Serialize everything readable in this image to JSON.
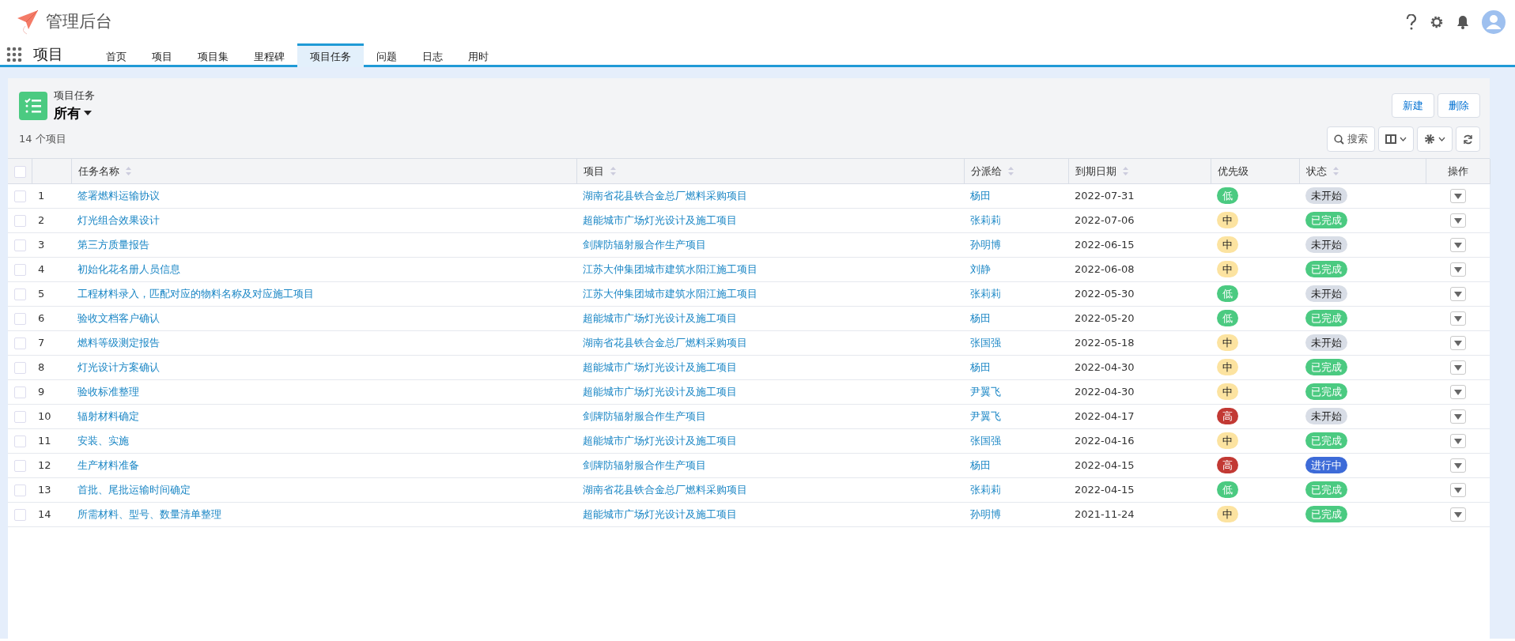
{
  "app": {
    "title": "管理后台"
  },
  "nav": {
    "section": "项目",
    "tabs": [
      {
        "label": "首页",
        "selected": false
      },
      {
        "label": "项目",
        "selected": false
      },
      {
        "label": "项目集",
        "selected": false
      },
      {
        "label": "里程碑",
        "selected": false
      },
      {
        "label": "项目任务",
        "selected": true
      },
      {
        "label": "问题",
        "selected": false
      },
      {
        "label": "日志",
        "selected": false
      },
      {
        "label": "用时",
        "selected": false
      }
    ]
  },
  "list_header": {
    "object": "项目任务",
    "view": "所有",
    "count": "14 个项目",
    "buttons": [
      "新建",
      "删除"
    ],
    "search_label": "搜索"
  },
  "table": {
    "all_checked": false,
    "columns": [
      {
        "label": "任务名称",
        "sortable": true
      },
      {
        "label": "项目",
        "sortable": true
      },
      {
        "label": "分派给",
        "sortable": true
      },
      {
        "label": "到期日期",
        "sortable": true
      },
      {
        "label": "优先级",
        "sortable": false
      },
      {
        "label": "状态",
        "sortable": true
      },
      {
        "label": "操作",
        "sortable": false
      }
    ],
    "rows": [
      {
        "num": "1",
        "name": "签署燃料运输协议",
        "project": "湖南省花县铁合金总厂燃料采购项目",
        "assignee": "杨田",
        "due": "2022-07-31",
        "priority": {
          "label": "低",
          "color": "#4bca81"
        },
        "status": {
          "label": "未开始",
          "color": "#d8dde6"
        },
        "checked": false
      },
      {
        "num": "2",
        "name": "灯光组合效果设计",
        "project": "超能城市广场灯光设计及施工项目",
        "assignee": "张莉莉",
        "due": "2022-07-06",
        "priority": {
          "label": "中",
          "color": "#fce3a0"
        },
        "status": {
          "label": "已完成",
          "color": "#4bca81"
        },
        "checked": false
      },
      {
        "num": "3",
        "name": "第三方质量报告",
        "project": "剑牌防辐射服合作生产项目",
        "assignee": "孙明博",
        "due": "2022-06-15",
        "priority": {
          "label": "中",
          "color": "#fce3a0"
        },
        "status": {
          "label": "未开始",
          "color": "#d8dde6"
        },
        "checked": false
      },
      {
        "num": "4",
        "name": "初始化花名册人员信息",
        "project": "江苏大仲集团城市建筑水阳江施工项目",
        "assignee": "刘静",
        "due": "2022-06-08",
        "priority": {
          "label": "中",
          "color": "#fce3a0"
        },
        "status": {
          "label": "已完成",
          "color": "#4bca81"
        },
        "checked": false
      },
      {
        "num": "5",
        "name": "工程材料录入，匹配对应的物料名称及对应施工项目",
        "project": "江苏大仲集团城市建筑水阳江施工项目",
        "assignee": "张莉莉",
        "due": "2022-05-30",
        "priority": {
          "label": "低",
          "color": "#4bca81"
        },
        "status": {
          "label": "未开始",
          "color": "#d8dde6"
        },
        "checked": false
      },
      {
        "num": "6",
        "name": "验收文档客户确认",
        "project": "超能城市广场灯光设计及施工项目",
        "assignee": "杨田",
        "due": "2022-05-20",
        "priority": {
          "label": "低",
          "color": "#4bca81"
        },
        "status": {
          "label": "已完成",
          "color": "#4bca81"
        },
        "checked": false
      },
      {
        "num": "7",
        "name": "燃料等级测定报告",
        "project": "湖南省花县铁合金总厂燃料采购项目",
        "assignee": "张国强",
        "due": "2022-05-18",
        "priority": {
          "label": "中",
          "color": "#fce3a0"
        },
        "status": {
          "label": "未开始",
          "color": "#d8dde6"
        },
        "checked": false
      },
      {
        "num": "8",
        "name": "灯光设计方案确认",
        "project": "超能城市广场灯光设计及施工项目",
        "assignee": "杨田",
        "due": "2022-04-30",
        "priority": {
          "label": "中",
          "color": "#fce3a0"
        },
        "status": {
          "label": "已完成",
          "color": "#4bca81"
        },
        "checked": false
      },
      {
        "num": "9",
        "name": "验收标准整理",
        "project": "超能城市广场灯光设计及施工项目",
        "assignee": "尹翼飞",
        "due": "2022-04-30",
        "priority": {
          "label": "中",
          "color": "#fce3a0"
        },
        "status": {
          "label": "已完成",
          "color": "#4bca81"
        },
        "checked": false
      },
      {
        "num": "10",
        "name": "辐射材料确定",
        "project": "剑牌防辐射服合作生产项目",
        "assignee": "尹翼飞",
        "due": "2022-04-17",
        "priority": {
          "label": "高",
          "color": "#c23934"
        },
        "status": {
          "label": "未开始",
          "color": "#d8dde6"
        },
        "checked": false
      },
      {
        "num": "11",
        "name": "安装、实施",
        "project": "超能城市广场灯光设计及施工项目",
        "assignee": "张国强",
        "due": "2022-04-16",
        "priority": {
          "label": "中",
          "color": "#fce3a0"
        },
        "status": {
          "label": "已完成",
          "color": "#4bca81"
        },
        "checked": false
      },
      {
        "num": "12",
        "name": "生产材料准备",
        "project": "剑牌防辐射服合作生产项目",
        "assignee": "杨田",
        "due": "2022-04-15",
        "priority": {
          "label": "高",
          "color": "#c23934"
        },
        "status": {
          "label": "进行中",
          "color": "#3d6bd8"
        },
        "checked": false
      },
      {
        "num": "13",
        "name": "首批、尾批运输时间确定",
        "project": "湖南省花县铁合金总厂燃料采购项目",
        "assignee": "张莉莉",
        "due": "2022-04-15",
        "priority": {
          "label": "低",
          "color": "#4bca81"
        },
        "status": {
          "label": "已完成",
          "color": "#4bca81"
        },
        "checked": false
      },
      {
        "num": "14",
        "name": "所需材料、型号、数量清单整理",
        "project": "超能城市广场灯光设计及施工项目",
        "assignee": "孙明博",
        "due": "2021-11-24",
        "priority": {
          "label": "中",
          "color": "#fce3a0"
        },
        "status": {
          "label": "已完成",
          "color": "#4bca81"
        },
        "checked": false
      }
    ]
  }
}
